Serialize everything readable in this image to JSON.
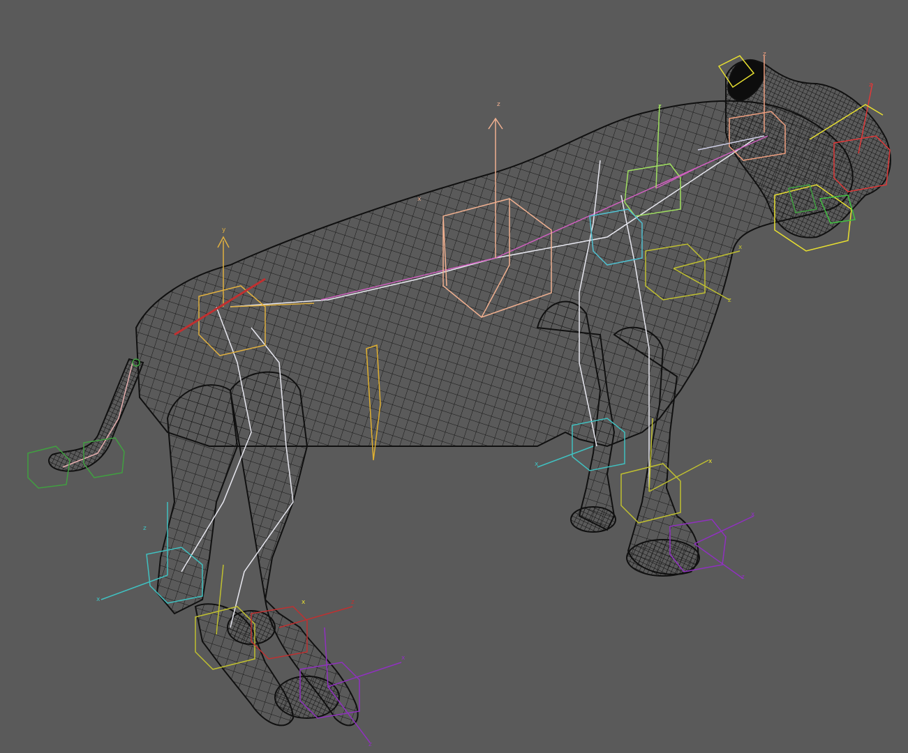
{
  "viewport": {
    "background_color": "#5a5a5a",
    "mesh_color": "#1a1a1a",
    "shading_mode": "wireframe"
  },
  "axis_labels": {
    "x": "x",
    "y": "y",
    "z": "z"
  },
  "bone_colors": {
    "spine": "#f0b090",
    "pelvis": "#e0b040",
    "head": "#f0a080",
    "neck": "#a0e060",
    "jaw": "#e8e030",
    "nose": "#e03838",
    "front_leg_left": "#40c0c0",
    "front_leg_right": "#c0c030",
    "rear_leg_left": "#40c0c0",
    "rear_leg_right": "#c0c030",
    "foot_left": "#9030c0",
    "foot_right": "#9030c0",
    "heel": "#c03030",
    "tail": "#40a040",
    "bone_links": "#e8e8f0",
    "center_of_mass": "#e0b030"
  }
}
